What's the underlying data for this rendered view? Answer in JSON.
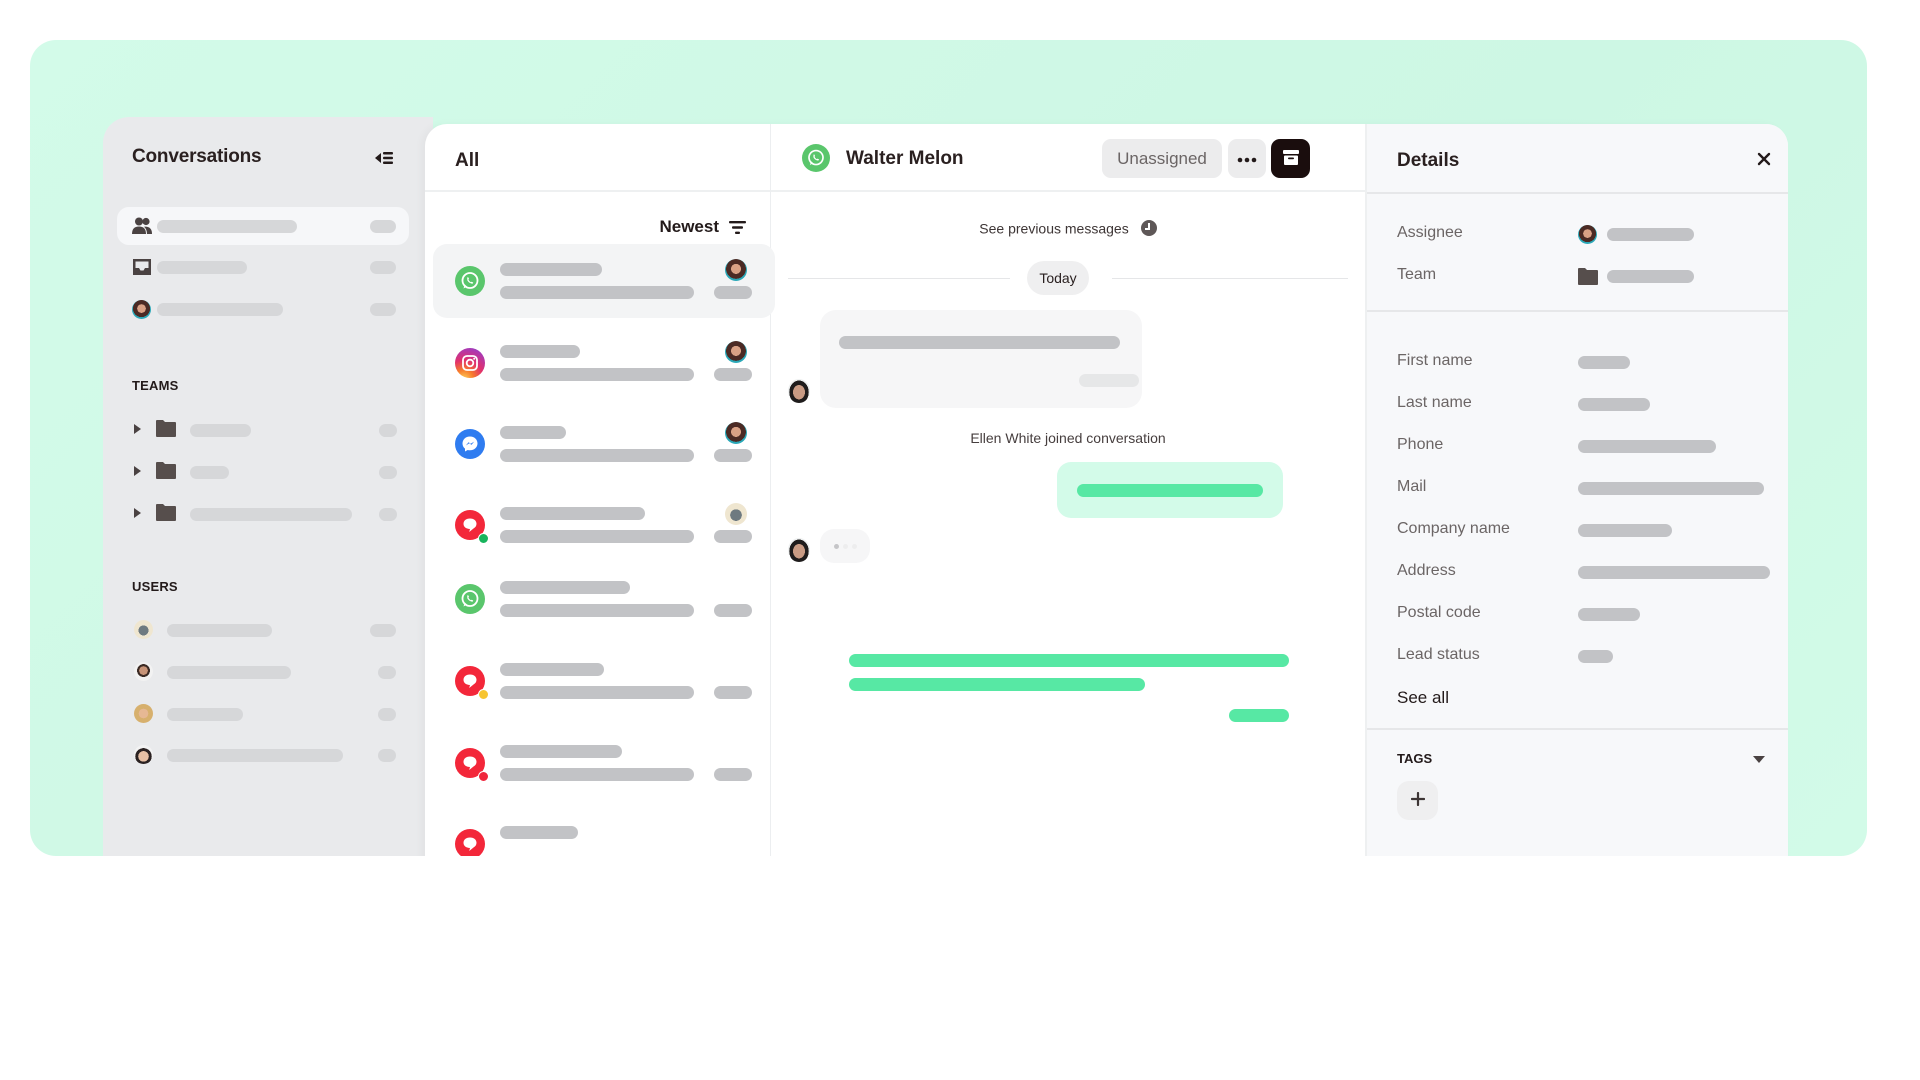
{
  "sidebar": {
    "title": "Conversations",
    "collapse_icon": "collapse-sidebar-icon",
    "inbox_items": [
      {
        "icon": "users-icon",
        "active": true
      },
      {
        "icon": "inbox-tray-icon",
        "active": false
      },
      {
        "icon": "avatar",
        "active": false
      }
    ],
    "teams_heading": "TEAMS",
    "teams": [
      {
        "icon": "folder-icon"
      },
      {
        "icon": "folder-icon"
      },
      {
        "icon": "folder-icon"
      }
    ],
    "users_heading": "USERS",
    "users": [
      {
        "avatar": "user-1"
      },
      {
        "avatar": "user-2"
      },
      {
        "avatar": "user-3"
      },
      {
        "avatar": "user-4"
      }
    ]
  },
  "list": {
    "title": "All",
    "sort_label": "Newest",
    "sort_icon": "filter-lines-icon",
    "conversations": [
      {
        "channel": "whatsapp",
        "active": true,
        "status": null
      },
      {
        "channel": "instagram",
        "active": false,
        "status": null
      },
      {
        "channel": "messenger",
        "active": false,
        "status": null
      },
      {
        "channel": "livechat",
        "active": false,
        "status": "online"
      },
      {
        "channel": "whatsapp",
        "active": false,
        "status": null
      },
      {
        "channel": "livechat",
        "active": false,
        "status": "away"
      },
      {
        "channel": "livechat",
        "active": false,
        "status": "offline"
      },
      {
        "channel": "livechat",
        "active": false,
        "status": null
      }
    ],
    "status_colors": {
      "online": "#18b45c",
      "away": "#f7c531",
      "offline": "#f0263c"
    }
  },
  "chat": {
    "contact_name": "Walter Melon",
    "channel": "whatsapp",
    "assign_button": "Unassigned",
    "more_icon": "more-horizontal-icon",
    "archive_icon": "archive-icon",
    "see_previous": "See previous messages",
    "day_separator": "Today",
    "system_message": "Ellen White joined conversation"
  },
  "details": {
    "title": "Details",
    "close_icon": "close-icon",
    "assignment": [
      {
        "label": "Assignee"
      },
      {
        "label": "Team"
      }
    ],
    "fields": [
      {
        "label": "First name"
      },
      {
        "label": "Last name"
      },
      {
        "label": "Phone"
      },
      {
        "label": "Mail"
      },
      {
        "label": "Company name"
      },
      {
        "label": "Address"
      },
      {
        "label": "Postal code"
      },
      {
        "label": "Lead status"
      }
    ],
    "see_all": "See all",
    "tags_heading": "TAGS",
    "add_tag_icon": "plus-icon"
  },
  "colors": {
    "accent_green": "#57e8a4",
    "bubble_green": "#d3fbe9",
    "whatsapp": "#5ac66c",
    "messenger": "#2f7cf0",
    "livechat": "#f3273a",
    "archive_button": "#1a0d0d"
  }
}
